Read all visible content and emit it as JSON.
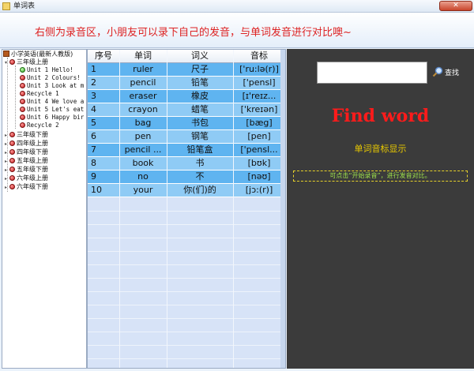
{
  "window": {
    "title": "单词表",
    "close_label": "✕"
  },
  "banner": {
    "message": "右侧为录音区，小朋友可以录下自己的发音，与单词发音进行对比噢~"
  },
  "tree": {
    "root": "小学英语(最新人教版)",
    "grade3a": "三年级上册",
    "units": [
      "Unit 1 Hello!",
      "Unit 2 Colours!",
      "Unit 3 Look at m",
      "Recycle 1",
      "Unit 4 We love a",
      "Unit 5 Let's eat",
      "Unit 6 Happy bir",
      "Recycle 2"
    ],
    "others": [
      "三年级下册",
      "四年级上册",
      "四年级下册",
      "五年级上册",
      "五年级下册",
      "六年级上册",
      "六年级下册"
    ]
  },
  "table": {
    "headers": [
      "序号",
      "单词",
      "词义",
      "音标"
    ],
    "rows": [
      [
        "1",
        "ruler",
        "尺子",
        "['ru:lə(r)]"
      ],
      [
        "2",
        "pencil",
        "铅笔",
        "['pensl]"
      ],
      [
        "3",
        "eraser",
        "橡皮",
        "[ɪ'reɪz..."
      ],
      [
        "4",
        "crayon",
        "蜡笔",
        "['kreɪən]"
      ],
      [
        "5",
        "bag",
        "书包",
        "[bæg]"
      ],
      [
        "6",
        "pen",
        "钢笔",
        "[pen]"
      ],
      [
        "7",
        "pencil ...",
        "铅笔盒",
        "['pensl..."
      ],
      [
        "8",
        "book",
        "书",
        "[bʊk]"
      ],
      [
        "9",
        "no",
        "不",
        "[nəʊ]"
      ],
      [
        "10",
        "your",
        "你(们)的",
        "[jɔ:(r)]"
      ]
    ]
  },
  "panel": {
    "search_value": "",
    "search_label": "查找",
    "search_icon": "magnifier-icon",
    "find_title": "Find word",
    "phonetic_label": "单词音标显示",
    "tip": "可点击“开始录音”，进行发音对比。"
  },
  "colors": {
    "row_dark": "#5fb4f0",
    "row_light": "#8fcbf5",
    "panel_bg": "#3b3b3b",
    "accent_red": "#ff1b1b"
  }
}
